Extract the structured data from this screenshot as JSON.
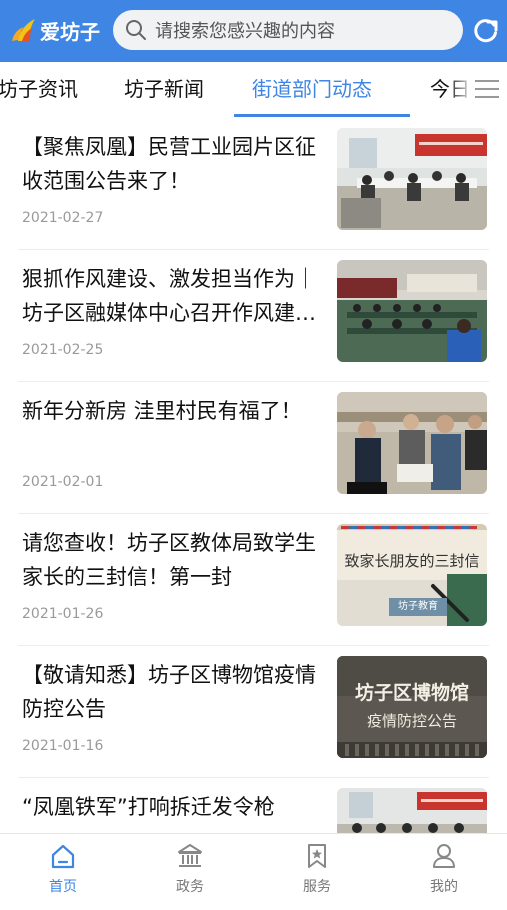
{
  "header": {
    "app_name": "爱坊子",
    "search_placeholder": "请搜索您感兴趣的内容",
    "brand_color": "#3f86e4",
    "icons": [
      "logo-flame-icon",
      "search-icon",
      "refresh-icon"
    ]
  },
  "tabs": {
    "items": [
      {
        "label": "坊子资讯",
        "active": false
      },
      {
        "label": "坊子新闻",
        "active": false
      },
      {
        "label": "街道部门动态",
        "active": true
      },
      {
        "label": "今日",
        "active": false
      }
    ],
    "menu_icon": "hamburger-menu-icon"
  },
  "feed": {
    "items": [
      {
        "title": "【聚焦凤凰】民营工业园片区征收范围公告来了！",
        "date": "2021-02-27",
        "thumb": "meeting-room-photo"
      },
      {
        "title": "狠抓作风建设、激发担当作为｜坊子区融媒体中心召开作风建设会议",
        "date": "2021-02-25",
        "thumb": "conference-hall-photo"
      },
      {
        "title": "新年分新房 洼里村民有福了！",
        "date": "2021-02-01",
        "thumb": "villagers-photo"
      },
      {
        "title": "请您查收！坊子区教体局致学生家长的三封信！第一封",
        "date": "2021-01-26",
        "thumb": "letter-photo",
        "thumb_text": [
          "致家长朋友的三封信",
          "坊子教育"
        ]
      },
      {
        "title": "【敬请知悉】坊子区博物馆疫情防控公告",
        "date": "2021-01-16",
        "thumb": "museum-notice-photo",
        "thumb_text": [
          "坊子区博物馆",
          "疫情防控公告"
        ]
      },
      {
        "title": "“凤凰铁军”打响拆迁发令枪",
        "date": "",
        "thumb": "meeting-room-photo-2"
      }
    ]
  },
  "bottom_nav": {
    "items": [
      {
        "label": "首页",
        "icon": "home-icon",
        "active": true
      },
      {
        "label": "政务",
        "icon": "government-building-icon",
        "active": false
      },
      {
        "label": "服务",
        "icon": "bookmark-star-icon",
        "active": false
      },
      {
        "label": "我的",
        "icon": "user-icon",
        "active": false
      }
    ]
  }
}
